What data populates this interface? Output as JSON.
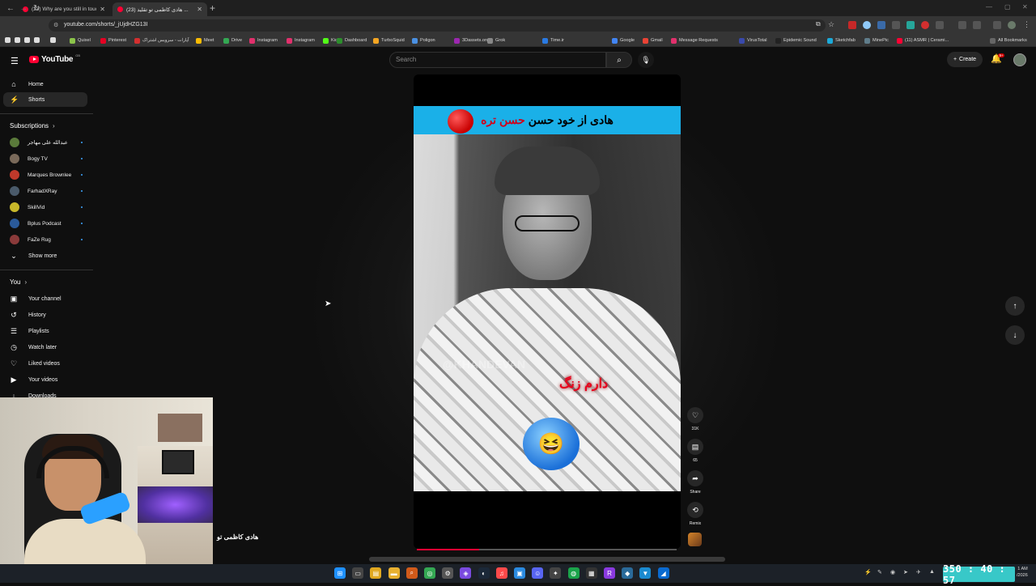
{
  "browser": {
    "tabs": [
      {
        "title": "(23) Why are you still in touch...",
        "active": false
      },
      {
        "title": "(23) هادی کاظمی تو تقلید ...",
        "active": true
      }
    ],
    "url": "youtube.com/shorts/_jUjdHZG13I",
    "bookmarks": [
      "Quixel",
      "Pinterest",
      "آپارات - سرویس اشتراک",
      "Meet",
      "Drive",
      "Instagram",
      "Instagram",
      "Kick",
      "Dashboard",
      "TurboSquid",
      "Poligon",
      "3Dassets.one",
      "Grok",
      "Time.ir",
      "Google",
      "Gmail",
      "Message Requests",
      "VirusTotal",
      "Epidemic Sound",
      "Sketchfab",
      "MinePic",
      "(11) ASMR | Cerami...",
      "All Bookmarks"
    ],
    "bookmark_colors": [
      "#8bc34a",
      "#e60023",
      "#d32f2f",
      "#fbbc04",
      "#34a853",
      "#e1306c",
      "#e1306c",
      "#53fc18",
      "#2d8f2d",
      "#f5a623",
      "#4a90e2",
      "#9c27b0",
      "#888888",
      "#2a7ae2",
      "#4285f4",
      "#ea4335",
      "#e1306c",
      "#3949ab",
      "#222222",
      "#1caad9",
      "#607d8b",
      "#ff0033",
      "#666666"
    ]
  },
  "youtube": {
    "logo": "YouTube",
    "region": "GB",
    "search_placeholder": "Search",
    "create_label": "Create",
    "notif_count": "9+",
    "nav": [
      {
        "label": "Home",
        "icon": "home-icon",
        "glyph": "⌂",
        "active": false
      },
      {
        "label": "Shorts",
        "icon": "shorts-icon",
        "glyph": "⚡",
        "active": true
      }
    ],
    "subscriptions_heading": "Subscriptions",
    "subscriptions": [
      {
        "name": "عبدالله علی مهاجر",
        "color": "#5a7a3a"
      },
      {
        "name": "Bogy TV",
        "color": "#7a6a5a"
      },
      {
        "name": "Marques Brownlee",
        "color": "#c0392b"
      },
      {
        "name": "FarhadXRay",
        "color": "#4a5a6a"
      },
      {
        "name": "SkillVid",
        "color": "#c8b82a"
      },
      {
        "name": "Bplus Podcast",
        "color": "#2a5a9a"
      },
      {
        "name": "FaZe Rug",
        "color": "#8a3a3a"
      }
    ],
    "show_more": "Show more",
    "you_heading": "You",
    "you_items": [
      {
        "label": "Your channel",
        "icon": "channel-icon",
        "glyph": "▣"
      },
      {
        "label": "History",
        "icon": "history-icon",
        "glyph": "↺"
      },
      {
        "label": "Playlists",
        "icon": "playlists-icon",
        "glyph": "☰"
      },
      {
        "label": "Watch later",
        "icon": "watch-later-icon",
        "glyph": "◷"
      },
      {
        "label": "Liked videos",
        "icon": "like-icon",
        "glyph": "♡"
      },
      {
        "label": "Your videos",
        "icon": "your-videos-icon",
        "glyph": "▶"
      },
      {
        "label": "Downloads",
        "icon": "download-icon",
        "glyph": "↓"
      }
    ]
  },
  "short": {
    "banner_text": "هادی از خود حسن",
    "banner_red": "حسن تره",
    "watermark": "@KHANDEVAN",
    "overlay_text": "دارم زنگ",
    "progress_fraction": 0.24,
    "actions": {
      "likes": "31K",
      "comments": "65",
      "share": "Share",
      "remix": "Remix"
    }
  },
  "webcam_caption": "هادی کاظمی تو",
  "taskbar": {
    "timer": "350 : 40 : 57",
    "clock_time": "1 AM",
    "clock_date": "/2026"
  }
}
